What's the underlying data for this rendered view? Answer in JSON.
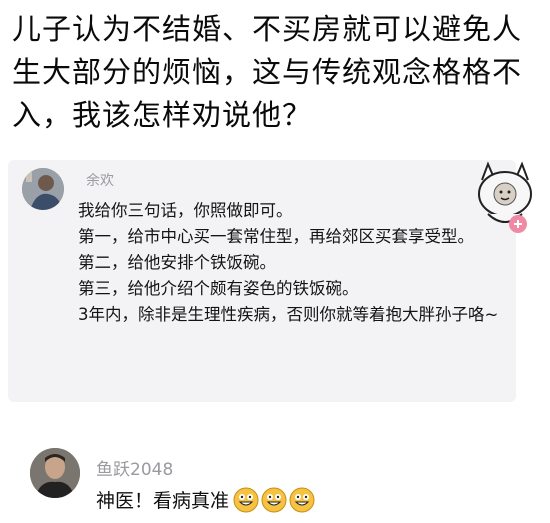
{
  "post": {
    "question": "儿子认为不结婚、不买房就可以避免人生大部分的烦恼，这与传统观念格格不入，我该怎样劝说他？"
  },
  "comment1": {
    "username": "余欢",
    "lines": [
      "我给你三句话，你照做即可。",
      "第一，给市中心买一套常住型，再给郊区买套享受型。",
      "第二，给他安排个铁饭碗。",
      "第三，给他介绍个颇有姿色的铁饭碗。",
      "3年内，除非是生理性疾病，否则你就等着抱大胖孙子咯~"
    ]
  },
  "comment2": {
    "username": "鱼跃2048",
    "text": "神医！看病真准"
  },
  "icons": {
    "sticker": "cartoon-face-sticker-icon",
    "emoji": "grinning-face-icon"
  },
  "colors": {
    "card_bg": "#f3f3f5",
    "username": "#9a9aa0",
    "sticker_plus": "#f08aa4"
  }
}
